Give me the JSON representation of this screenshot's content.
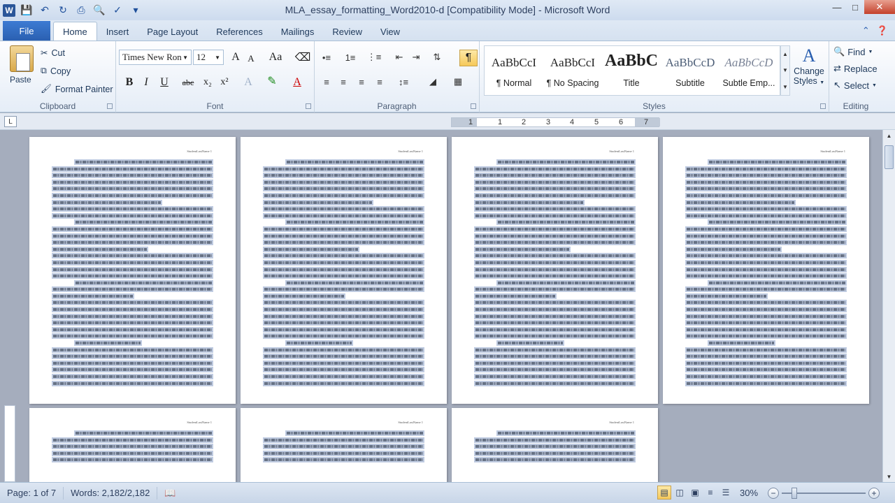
{
  "window": {
    "title": "MLA_essay_formatting_Word2010-d [Compatibility Mode]  -  Microsoft Word"
  },
  "tabs": [
    {
      "label": "File"
    },
    {
      "label": "Home"
    },
    {
      "label": "Insert"
    },
    {
      "label": "Page Layout"
    },
    {
      "label": "References"
    },
    {
      "label": "Mailings"
    },
    {
      "label": "Review"
    },
    {
      "label": "View"
    }
  ],
  "clipboard": {
    "paste_label": "Paste",
    "cut_label": "Cut",
    "copy_label": "Copy",
    "format_painter_label": "Format Painter",
    "group_label": "Clipboard"
  },
  "font": {
    "family": "Times New Ron",
    "size": "12",
    "grow": "A",
    "shrink": "A",
    "change_case": "Aa",
    "bold": "B",
    "italic": "I",
    "underline": "U",
    "strikethrough": "abc",
    "subscript": "x₂",
    "superscript": "x²",
    "text_effects": "A",
    "font_color": "A",
    "group_label": "Font"
  },
  "paragraph": {
    "group_label": "Paragraph",
    "show_marks": "¶"
  },
  "styles": {
    "group_label": "Styles",
    "items": [
      {
        "sample": "AaBbCcI",
        "name": "¶ Normal"
      },
      {
        "sample": "AaBbCcI",
        "name": "¶ No Spacing"
      },
      {
        "sample": "AaBbC",
        "name": "Title"
      },
      {
        "sample": "AaBbCcD",
        "name": "Subtitle"
      },
      {
        "sample": "AaBbCcD",
        "name": "Subtle Emp..."
      }
    ],
    "change_styles_label_1": "Change",
    "change_styles_label_2": "Styles"
  },
  "editing": {
    "group_label": "Editing",
    "find_label": "Find",
    "replace_label": "Replace",
    "select_label": "Select"
  },
  "ruler": {
    "numbers": [
      "1",
      "1",
      "2",
      "3",
      "4",
      "5",
      "6",
      "7"
    ]
  },
  "pages": {
    "header_text": "StudentLastName 1"
  },
  "status": {
    "page": "Page: 1 of 7",
    "words": "Words: 2,182/2,182",
    "zoom": "30%"
  },
  "colors": {
    "accent": "#2a5fb0",
    "selection": "#b4c3dc"
  }
}
